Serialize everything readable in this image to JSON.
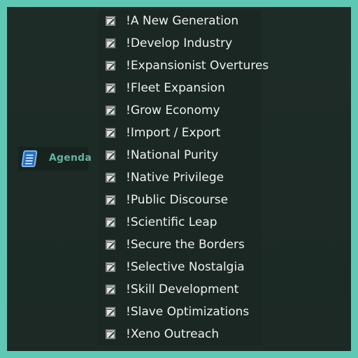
{
  "sidebar": {
    "agenda_label": "Agenda",
    "agenda_icon": "agenda-book-icon"
  },
  "agenda_list": {
    "item_icon": "edit-document-icon",
    "items": [
      "!A New Generation",
      "!Develop Industry",
      "!Expansionist Overtures",
      "!Fleet Expansion",
      "!Grow Economy",
      "!Import / Export",
      "!National Purity",
      "!Native Privilege",
      "!Public Discourse",
      "!Scientific Leap",
      "!Secure the Borders",
      "!Selective Nostalgia",
      "!Skill Development",
      "!Slave Optimizations",
      "!Xeno Outreach"
    ]
  },
  "colors": {
    "frame_border": "#5fc8b4",
    "background": "#1d2b27",
    "agenda_text": "#66b0a0",
    "item_text": "#eef1ee"
  }
}
